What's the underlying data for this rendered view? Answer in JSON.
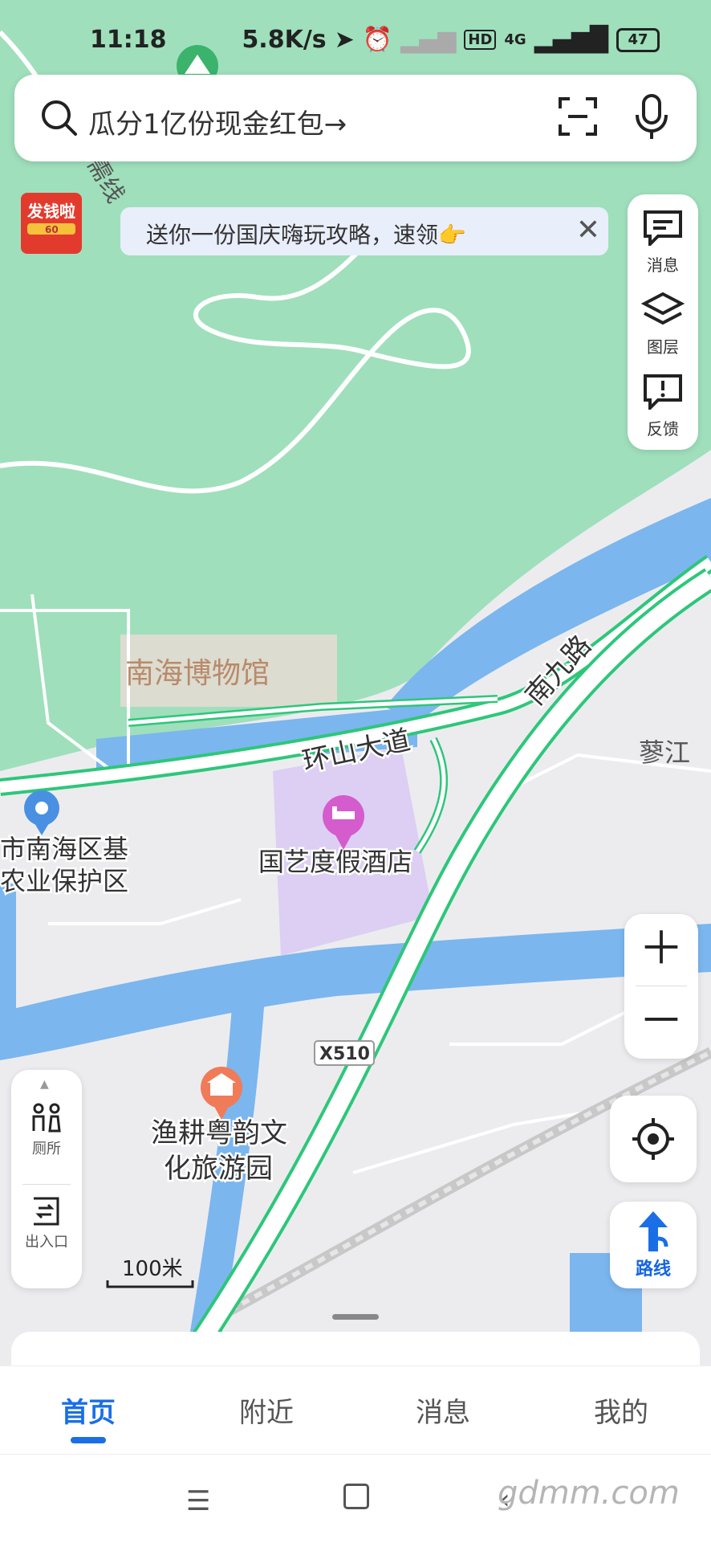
{
  "status_bar": {
    "time": "11:18",
    "net_speed": "5.8K/s",
    "network": "4G",
    "battery": "47"
  },
  "search": {
    "placeholder": "瓜分1亿份现金红包→"
  },
  "promo": {
    "label": "发钱啦",
    "amount": "60"
  },
  "banner": {
    "text": "送你一份国庆嗨玩攻略，速领👉"
  },
  "right_tools": {
    "messages": "消息",
    "layers": "图层",
    "feedback": "反馈"
  },
  "left_tools": {
    "toilet": "厕所",
    "entrance": "出入口"
  },
  "route_button": {
    "label": "路线"
  },
  "map": {
    "labels": {
      "road_top": "南海博物馆",
      "museum": "南海博物馆",
      "huanshan": "环山大道",
      "nanjiu": "南九路",
      "liaojiang": "蓼江",
      "hotel": "国艺度假酒店",
      "reserve_1": "市南海区基",
      "reserve_2": "农业保护区",
      "park_1": "渔耕粤韵文",
      "park_2": "化旅游园",
      "road_code": "X510",
      "partial_road": "需线"
    },
    "scale": "100米"
  },
  "tabs": [
    {
      "label": "首页"
    },
    {
      "label": "附近"
    },
    {
      "label": "消息"
    },
    {
      "label": "我的"
    }
  ],
  "watermark": "gdmm.com"
}
